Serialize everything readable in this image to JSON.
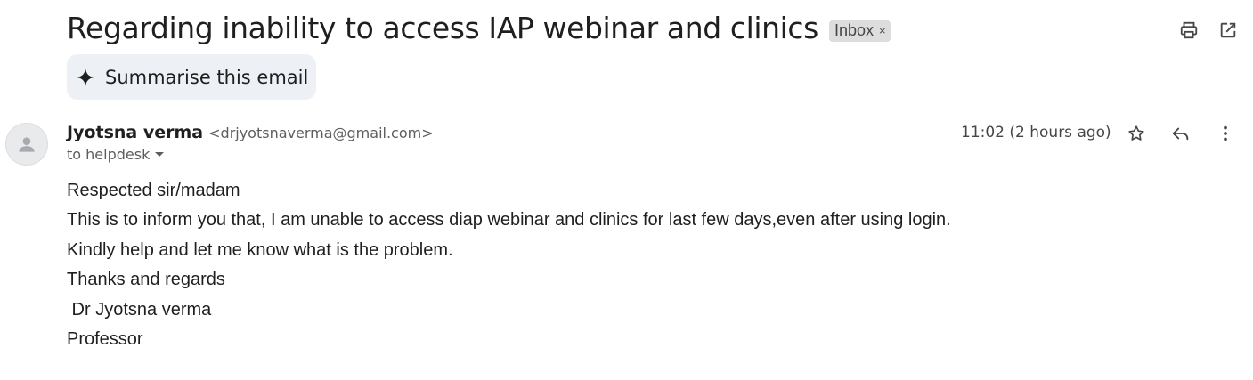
{
  "email": {
    "subject": "Regarding inability to access IAP webinar and clinics",
    "label": "Inbox",
    "label_remove": "×",
    "summarise_label": "Summarise this email",
    "sender_name": "Jyotsna verma",
    "sender_email": "<drjyotsnaverma@gmail.com>",
    "to": "to helpdesk",
    "time": "11:02 (2 hours ago)",
    "body_lines": [
      "Respected sir/madam",
      "This is to inform you that, I am unable to access diap webinar and clinics for last few days,even after using login.",
      "Kindly help and let me know what is the problem.",
      "Thanks and regards",
      " Dr Jyotsna verma",
      "Professor"
    ]
  },
  "icons": {
    "print": "print-icon",
    "popout": "open-in-new-window-icon",
    "spark": "sparkle-icon",
    "avatar": "person-icon",
    "star": "star-icon",
    "reply": "reply-icon",
    "more": "more-vert-icon"
  }
}
